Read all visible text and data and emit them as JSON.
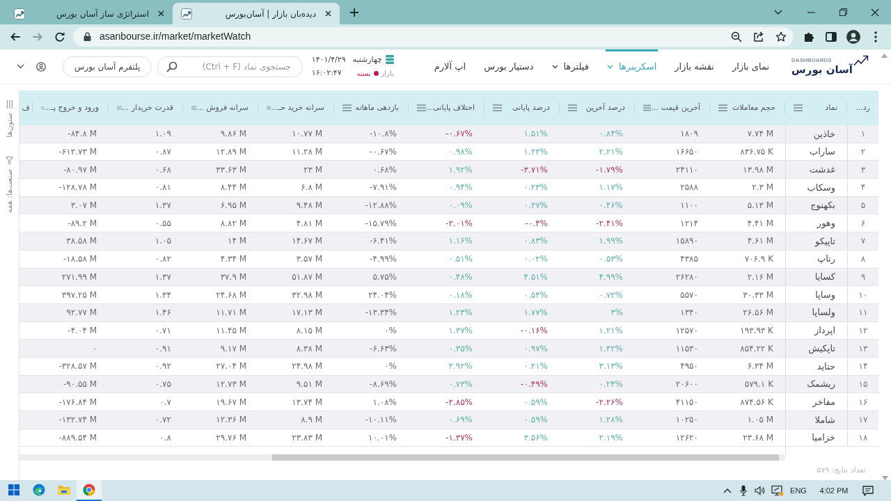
{
  "browser": {
    "tabs": [
      {
        "title": "دیده‌بان بازار | آسان‌بورس",
        "selected": true
      },
      {
        "title": "استراتژی ساز آسان بورس",
        "selected": false
      }
    ],
    "url": "asanbourse.ir/market/marketWatch"
  },
  "header": {
    "logo": {
      "subtitle": "DASHBOARDS",
      "name": "آسان بورس"
    },
    "nav": [
      {
        "label": "نمای بازار",
        "selected": false,
        "dropdown": false
      },
      {
        "label": "نقشه بازار",
        "selected": false,
        "dropdown": false
      },
      {
        "label": "اسکرینرها",
        "selected": true,
        "dropdown": true
      },
      {
        "label": "فیلترها",
        "selected": false,
        "dropdown": true
      },
      {
        "label": "دستیار بورس",
        "selected": false,
        "dropdown": false
      },
      {
        "label": "اپ آلارم",
        "selected": false,
        "dropdown": false
      }
    ],
    "market": {
      "day": "چهارشنبه",
      "date": "۱۴۰۱/۴/۲۹",
      "label": "بازار",
      "status": "بسته",
      "open": false,
      "time": "۱۶:۰۲:۴۷"
    },
    "search": {
      "placeholder": "جستجوی نماد (Ctrl + F)"
    },
    "platform_button": "پلتفرم آسان بورس"
  },
  "side_bar": [
    {
      "kind": "columns",
      "label": "ستون‌ها"
    },
    {
      "kind": "filter",
      "label": "صنعت‌ها: همه"
    }
  ],
  "table": {
    "columns": [
      {
        "label": "رد...",
        "menu": false
      },
      {
        "label": "نماد",
        "menu": true
      },
      {
        "label": "حجم معاملات",
        "menu": true
      },
      {
        "label": "آخرین قیمت ...",
        "menu": true
      },
      {
        "label": "درصد آخرین",
        "menu": true
      },
      {
        "label": "درصد پایانی",
        "menu": true
      },
      {
        "label": "اختلاف پایانی...",
        "menu": true
      },
      {
        "label": "بازدهی ماهانه",
        "menu": true
      },
      {
        "label": "سرانه خرید حـ...",
        "menu": true
      },
      {
        "label": "سرانه فروش ...",
        "menu": true
      },
      {
        "label": "قدرت خریدار ...",
        "menu": true
      },
      {
        "label": "ورود و خروج پـ...",
        "menu": true
      },
      {
        "label": "ف",
        "menu": false
      }
    ],
    "rows": [
      {
        "cells": [
          {
            "text": "۱"
          },
          {
            "text": "خاذین"
          },
          {
            "text": "۷.۷۴ M"
          },
          {
            "text": "۱۸۰۹"
          },
          {
            "text": "۰.۸۴%",
            "color": "#5fb0a7"
          },
          {
            "text": "۱.۵۱%",
            "color": "#5fb0a7"
          },
          {
            "text": "-۰.۶۷%",
            "color": "#b03a62"
          },
          {
            "text": "-۱۰.۸%"
          },
          {
            "text": "۱۰.۷۷ M"
          },
          {
            "text": "۹.۸۶ M"
          },
          {
            "text": "۱.۰۹"
          },
          {
            "text": "-۸۴.۸ M"
          }
        ]
      },
      {
        "cells": [
          {
            "text": "۲"
          },
          {
            "text": "ساراب"
          },
          {
            "text": "۸۳۶.۷۵ K"
          },
          {
            "text": "۱۶۶۵۰"
          },
          {
            "text": "۲.۲۱%",
            "color": "#5fb0a7"
          },
          {
            "text": "۱.۲۳%",
            "color": "#5fb0a7"
          },
          {
            "text": "۰.۹۸%",
            "color": "#5fb0a7"
          },
          {
            "text": "-۰.۶۷%"
          },
          {
            "text": "۱۱.۲۸ M"
          },
          {
            "text": "۱۲.۸۹ M"
          },
          {
            "text": "۰.۸۷"
          },
          {
            "text": "-۶۱۲.۷۳ M"
          }
        ]
      },
      {
        "cells": [
          {
            "text": "۳"
          },
          {
            "text": "غدشت"
          },
          {
            "text": "۱۳.۹۸ M"
          },
          {
            "text": "۲۴۱۱۰"
          },
          {
            "text": "-۱.۷۹%",
            "color": "#b03a62"
          },
          {
            "text": "-۳.۷۱%",
            "color": "#b03a62"
          },
          {
            "text": "۱.۹۲%",
            "color": "#5fb0a7"
          },
          {
            "text": "۰.۶۸%"
          },
          {
            "text": "۲۳ M"
          },
          {
            "text": "۳۳.۶۳ M"
          },
          {
            "text": "۰.۶۸"
          },
          {
            "text": "-۸۰.۹۷ M"
          }
        ]
      },
      {
        "cells": [
          {
            "text": "۴"
          },
          {
            "text": "وسکاب"
          },
          {
            "text": "۲.۳ M"
          },
          {
            "text": "۲۵۸۸"
          },
          {
            "text": "۱.۱۷%",
            "color": "#5fb0a7"
          },
          {
            "text": "۰.۲۳%",
            "color": "#5fb0a7"
          },
          {
            "text": "۰.۹۴%",
            "color": "#5fb0a7"
          },
          {
            "text": "-۷.۹۱%"
          },
          {
            "text": "۶.۸ M"
          },
          {
            "text": "۸.۴۴ M"
          },
          {
            "text": "۰.۸۱"
          },
          {
            "text": "-۱۲۸.۷۸ M"
          }
        ]
      },
      {
        "cells": [
          {
            "text": "۵"
          },
          {
            "text": "بکهنوج"
          },
          {
            "text": "۵.۱۳ M"
          },
          {
            "text": "۱۱۰۰"
          },
          {
            "text": "۰.۴۶%",
            "color": "#5fb0a7"
          },
          {
            "text": "۰.۳۷%",
            "color": "#5fb0a7"
          },
          {
            "text": "۰.۰۹%",
            "color": "#5fb0a7"
          },
          {
            "text": "-۱۲.۸۸%"
          },
          {
            "text": "۹.۴۸ M"
          },
          {
            "text": "۶.۹۵ M"
          },
          {
            "text": "۱.۳۷"
          },
          {
            "text": "۳.۰۷ M"
          }
        ]
      },
      {
        "cells": [
          {
            "text": "۶"
          },
          {
            "text": "وهور"
          },
          {
            "text": "۴.۴۱ M"
          },
          {
            "text": "۱۲۱۴"
          },
          {
            "text": "-۲.۴۱%",
            "color": "#b03a62"
          },
          {
            "text": "-۰.۴%",
            "color": "#b03a62"
          },
          {
            "text": "-۲.۰۱%",
            "color": "#b03a62"
          },
          {
            "text": "-۱۵.۷۹%"
          },
          {
            "text": "۴.۸۱ M"
          },
          {
            "text": "۸.۸۲ M"
          },
          {
            "text": "۰.۵۵"
          },
          {
            "text": "-۸۹.۲ M"
          }
        ]
      },
      {
        "cells": [
          {
            "text": "۷"
          },
          {
            "text": "تاپیکو"
          },
          {
            "text": "۴.۶۱ M"
          },
          {
            "text": "۱۵۸۹۰"
          },
          {
            "text": "۱.۹۹%",
            "color": "#5fb0a7"
          },
          {
            "text": "۰.۸۳%",
            "color": "#5fb0a7"
          },
          {
            "text": "۱.۱۶%",
            "color": "#5fb0a7"
          },
          {
            "text": "-۶.۴۱%"
          },
          {
            "text": "۱۴.۶۷ M"
          },
          {
            "text": "۱۴ M"
          },
          {
            "text": "۱.۰۵"
          },
          {
            "text": "۳۸.۵۸ M"
          }
        ]
      },
      {
        "cells": [
          {
            "text": "۸"
          },
          {
            "text": "رتاپ"
          },
          {
            "text": "۷۰۶.۹ K"
          },
          {
            "text": "۴۳۸۵"
          },
          {
            "text": "۰.۵۳%",
            "color": "#5fb0a7"
          },
          {
            "text": "۰.۰۲%",
            "color": "#5fb0a7"
          },
          {
            "text": "۰.۵۱%",
            "color": "#5fb0a7"
          },
          {
            "text": "-۴.۹۹%"
          },
          {
            "text": "۳.۵۷ M"
          },
          {
            "text": "۴.۳۴ M"
          },
          {
            "text": "۰.۸۲"
          },
          {
            "text": "-۱۸.۵۸ M"
          }
        ]
      },
      {
        "cells": [
          {
            "text": "۹"
          },
          {
            "text": "کسایا"
          },
          {
            "text": "۲.۱۶ M"
          },
          {
            "text": "۲۶۲۸۰"
          },
          {
            "text": "۴.۹۹%",
            "color": "#5fb0a7"
          },
          {
            "text": "۴.۵۱%",
            "color": "#5fb0a7"
          },
          {
            "text": "۰.۴۸%",
            "color": "#5fb0a7"
          },
          {
            "text": "۵.۷۵%"
          },
          {
            "text": "۵۱.۸۷ M"
          },
          {
            "text": "۳۷.۹ M"
          },
          {
            "text": "۱.۳۷"
          },
          {
            "text": "۲۷۱.۹۹ M"
          }
        ]
      },
      {
        "cells": [
          {
            "text": "۱۰"
          },
          {
            "text": "وساپا"
          },
          {
            "text": "۳۰.۳۳ M"
          },
          {
            "text": "۵۵۷۰"
          },
          {
            "text": "۰.۷۲%",
            "color": "#5fb0a7"
          },
          {
            "text": "۰.۵۴%",
            "color": "#5fb0a7"
          },
          {
            "text": "۰.۱۸%",
            "color": "#5fb0a7"
          },
          {
            "text": "۲۴.۰۴%"
          },
          {
            "text": "۳۲.۹۸ M"
          },
          {
            "text": "۲۴.۶۸ M"
          },
          {
            "text": "۱.۳۴"
          },
          {
            "text": "۳۹۷.۲۵ M"
          }
        ]
      },
      {
        "cells": [
          {
            "text": "۱۱"
          },
          {
            "text": "ولساپا"
          },
          {
            "text": "۲۶.۵۶ M"
          },
          {
            "text": "۱۳۴۰"
          },
          {
            "text": "۳%",
            "color": "#5fb0a7"
          },
          {
            "text": "۱.۷۷%",
            "color": "#5fb0a7"
          },
          {
            "text": "۱.۲۳%",
            "color": "#5fb0a7"
          },
          {
            "text": "-۱۳.۳۴%"
          },
          {
            "text": "۱۷.۱۳ M"
          },
          {
            "text": "۱۱.۷۱ M"
          },
          {
            "text": "۱.۴۶"
          },
          {
            "text": "۹۲.۷۷ M"
          }
        ]
      },
      {
        "cells": [
          {
            "text": "۱۲"
          },
          {
            "text": "اپرداز"
          },
          {
            "text": "۱۹۳.۹۳ K"
          },
          {
            "text": "۱۲۵۷۰"
          },
          {
            "text": "۱.۲۱%",
            "color": "#5fb0a7"
          },
          {
            "text": "-۰.۱۶%",
            "color": "#b03a62"
          },
          {
            "text": "۱.۳۷%",
            "color": "#5fb0a7"
          },
          {
            "text": "۰%"
          },
          {
            "text": "۸.۱۵ M"
          },
          {
            "text": "۱۱.۴۵ M"
          },
          {
            "text": "۰.۷۱"
          },
          {
            "text": "-۴.۰۴ M"
          }
        ]
      },
      {
        "cells": [
          {
            "text": "۱۳"
          },
          {
            "text": "تاپکیش"
          },
          {
            "text": "۸۵۴.۲۲ K"
          },
          {
            "text": "۱۱۵۳۰"
          },
          {
            "text": "۱.۳۲%",
            "color": "#5fb0a7"
          },
          {
            "text": "۰.۹۷%",
            "color": "#5fb0a7"
          },
          {
            "text": "۰.۳۵%",
            "color": "#5fb0a7"
          },
          {
            "text": "-۶.۶۳%"
          },
          {
            "text": "۸.۳۸ M"
          },
          {
            "text": "۹.۱۷ M"
          },
          {
            "text": "۰.۹۱"
          },
          {
            "text": "۰"
          }
        ]
      },
      {
        "cells": [
          {
            "text": "۱۴"
          },
          {
            "text": "حتاید"
          },
          {
            "text": "۶.۳۴ M"
          },
          {
            "text": "۴۹۵۰"
          },
          {
            "text": "۳.۱۳%",
            "color": "#5fb0a7"
          },
          {
            "text": "۰.۲۱%",
            "color": "#5fb0a7"
          },
          {
            "text": "۲.۹۲%",
            "color": "#5fb0a7"
          },
          {
            "text": "۰%"
          },
          {
            "text": "۲۴.۹۸ M"
          },
          {
            "text": "۲۷.۰۴ M"
          },
          {
            "text": "۰.۹۲"
          },
          {
            "text": "-۳۲۸.۵۷ M"
          }
        ]
      },
      {
        "cells": [
          {
            "text": "۱۵"
          },
          {
            "text": "ریشمک"
          },
          {
            "text": "۵۷۹.۱ K"
          },
          {
            "text": "۲۰۶۰۰"
          },
          {
            "text": "۰.۲۴%",
            "color": "#5fb0a7"
          },
          {
            "text": "-۰.۴۹%",
            "color": "#b03a62"
          },
          {
            "text": "۰.۷۳%",
            "color": "#5fb0a7"
          },
          {
            "text": "-۸.۶۹%"
          },
          {
            "text": "۹.۵۱ M"
          },
          {
            "text": "۱۲.۷۳ M"
          },
          {
            "text": "۰.۷۵"
          },
          {
            "text": "-۹۰.۵۵ M"
          }
        ]
      },
      {
        "cells": [
          {
            "text": "۱۶"
          },
          {
            "text": "مفاخر"
          },
          {
            "text": "۸۷۴.۵۶ K"
          },
          {
            "text": "۴۱۱۵۰"
          },
          {
            "text": "-۲.۲۶%",
            "color": "#b03a62"
          },
          {
            "text": "۰.۵۹%",
            "color": "#5fb0a7"
          },
          {
            "text": "-۲.۸۵%",
            "color": "#b03a62"
          },
          {
            "text": "۱.۰۸%"
          },
          {
            "text": "۱۳.۷۴ M"
          },
          {
            "text": "۱۹.۶۷ M"
          },
          {
            "text": "۰.۷"
          },
          {
            "text": "-۱۷۶.۸۴ M"
          }
        ]
      },
      {
        "cells": [
          {
            "text": "۱۷"
          },
          {
            "text": "شاملا"
          },
          {
            "text": "۱.۰۵ M"
          },
          {
            "text": "۱۰۲۵۰"
          },
          {
            "text": "۱.۲۸%",
            "color": "#5fb0a7"
          },
          {
            "text": "۰.۵۹%",
            "color": "#5fb0a7"
          },
          {
            "text": "۰.۶۹%",
            "color": "#5fb0a7"
          },
          {
            "text": "-۱۰.۱۱%"
          },
          {
            "text": "۸.۹ M"
          },
          {
            "text": "۱۲.۳۶ M"
          },
          {
            "text": "۰.۷۲"
          },
          {
            "text": "-۱۳۲.۷۴ M"
          }
        ]
      },
      {
        "cells": [
          {
            "text": "۱۸"
          },
          {
            "text": "خزامیا"
          },
          {
            "text": "۲۳.۶۸ M"
          },
          {
            "text": "۱۲۶۲۰"
          },
          {
            "text": "۲.۱۹%",
            "color": "#5fb0a7"
          },
          {
            "text": "۳.۵۶%",
            "color": "#5fb0a7"
          },
          {
            "text": "-۱.۳۷%",
            "color": "#b03a62"
          },
          {
            "text": "۱۰.۰۱%"
          },
          {
            "text": "۲۳.۸۳ M"
          },
          {
            "text": "۲۹.۷۶ M"
          },
          {
            "text": "۰.۸"
          },
          {
            "text": "-۸۸۹.۵۴ M"
          }
        ]
      }
    ]
  },
  "result_count": "تعداد نتایج: ۵۷۹",
  "taskbar": {
    "apps": [
      {
        "kind": "start",
        "selected": false
      },
      {
        "kind": "edge",
        "selected": false
      },
      {
        "kind": "explorer",
        "selected": false
      },
      {
        "kind": "chrome",
        "selected": true
      }
    ],
    "language": "ENG",
    "time": "4:02 PM"
  }
}
